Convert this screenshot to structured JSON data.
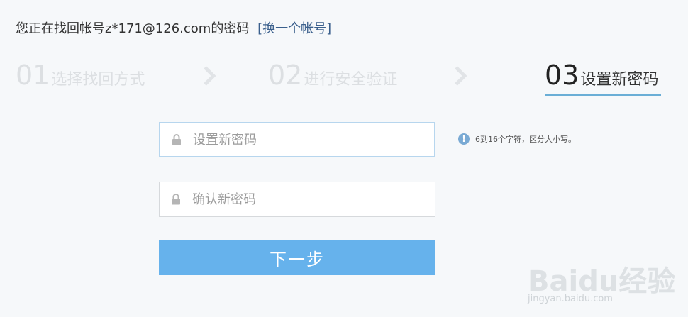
{
  "header": {
    "prefix": "您正在找回帐号z*171@126.com的密码",
    "switch_link": "[换一个帐号]"
  },
  "steps": [
    {
      "num": "01",
      "label": "选择找回方式",
      "state": "done"
    },
    {
      "num": "02",
      "label": "进行安全验证",
      "state": "done"
    },
    {
      "num": "03",
      "label": "设置新密码",
      "state": "active"
    }
  ],
  "form": {
    "new_password_placeholder": "设置新密码",
    "confirm_password_placeholder": "确认新密码",
    "hint_icon": "!",
    "hint": "6到16个字符，区分大小写。",
    "next_button": "下一步"
  },
  "watermark": {
    "brand": "Baidu经验",
    "url": "jingyan.baidu.com"
  },
  "colors": {
    "accent": "#66b2ec",
    "step_underline": "#6aaed6",
    "link": "#3a5f8c",
    "focus_border": "#b7d6ee",
    "info_icon": "#7aaad4"
  },
  "icons": {
    "lock": "lock-icon",
    "info": "info-icon",
    "chevron": "chevron-right-icon"
  }
}
